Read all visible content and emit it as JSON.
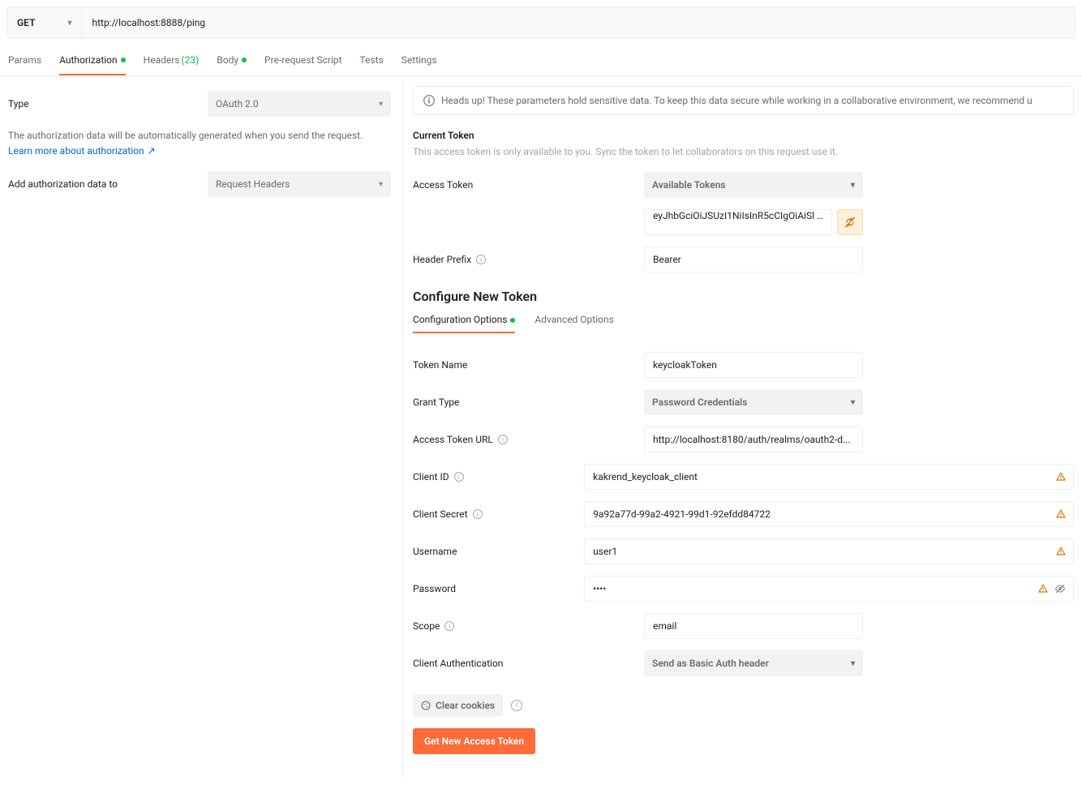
{
  "request": {
    "method": "GET",
    "url": "http://localhost:8888/ping"
  },
  "tabs": {
    "params": "Params",
    "authorization": "Authorization",
    "headers": "Headers",
    "headers_count": "(23)",
    "body": "Body",
    "prerequest": "Pre-request Script",
    "tests": "Tests",
    "settings": "Settings"
  },
  "left": {
    "type_label": "Type",
    "type_value": "OAuth 2.0",
    "desc": "The authorization data will be automatically generated when you send the request.",
    "learn_more": "Learn more about authorization",
    "add_to_label": "Add authorization data to",
    "add_to_value": "Request Headers"
  },
  "banner": "Heads up! These parameters hold sensitive data. To keep this data secure while working in a collaborative environment, we recommend u",
  "current_token": {
    "heading": "Current Token",
    "sub": "This access token is only available to you. Sync the token to let collaborators on this request use it.",
    "access_token_label": "Access Token",
    "available_tokens": "Available Tokens",
    "token_value": "eyJhbGciOiJSUzI1NiIsInR5cCIgOiAiSl ...",
    "header_prefix_label": "Header Prefix",
    "header_prefix_value": "Bearer"
  },
  "configure": {
    "heading": "Configure New Token",
    "tab_config": "Configuration Options",
    "tab_advanced": "Advanced Options",
    "token_name_label": "Token Name",
    "token_name_value": "keycloakToken",
    "grant_type_label": "Grant Type",
    "grant_type_value": "Password Credentials",
    "access_token_url_label": "Access Token URL",
    "access_token_url_value": "http://localhost:8180/auth/realms/oauth2-d...",
    "client_id_label": "Client ID",
    "client_id_value": "kakrend_keycloak_client",
    "client_secret_label": "Client Secret",
    "client_secret_value": "9a92a77d-99a2-4921-99d1-92efdd84722",
    "username_label": "Username",
    "username_value": "user1",
    "password_label": "Password",
    "password_value": "••••",
    "scope_label": "Scope",
    "scope_value": "email",
    "client_auth_label": "Client Authentication",
    "client_auth_value": "Send as Basic Auth header",
    "clear_cookies": "Clear cookies",
    "get_token": "Get New Access Token"
  }
}
